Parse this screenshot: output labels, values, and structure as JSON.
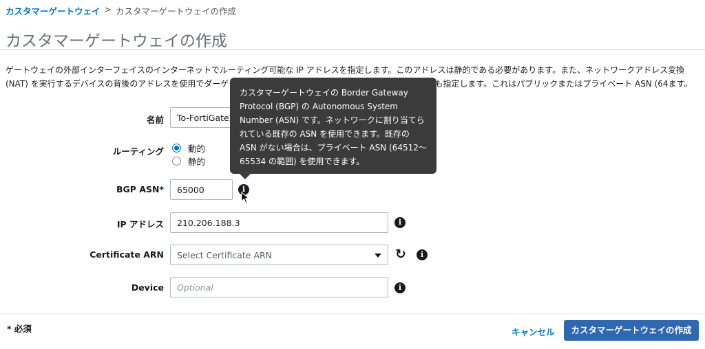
{
  "breadcrumb": {
    "parent": "カスタマーゲートウェイ",
    "separator": ">",
    "current": "カスタマーゲートウェイの作成"
  },
  "page_title": "カスタマーゲートウェイの作成",
  "description": "ゲートウェイの外部インターフェイスのインターネットでルーティング可能な IP アドレスを指定します。このアドレスは静的である必要があります。また、ネットワークアドレス変換 (NAT) を実行するデバイスの背後のアドレスを使用でダーゲートウェイプロトコル (BGP) 自律システム番号 (ASN) も指定します。これはパブリックまたはプライベート ASN (64ます。",
  "form": {
    "name": {
      "label": "名前",
      "value": "To-FortiGate2"
    },
    "routing": {
      "label": "ルーティング",
      "options": [
        "動的",
        "静的"
      ],
      "selected": "動的"
    },
    "bgp_asn": {
      "label": "BGP ASN*",
      "value": "65000"
    },
    "ip_address": {
      "label": "IP アドレス",
      "value": "210.206.188.3"
    },
    "certificate_arn": {
      "label": "Certificate ARN",
      "placeholder": "Select Certificate ARN"
    },
    "device": {
      "label": "Device",
      "placeholder": "Optional"
    }
  },
  "tooltip": {
    "text": "カスタマーゲートウェイの Border Gateway Protocol (BGP) の Autonomous System Number (ASN) です。ネットワークに割り当てられている既存の ASN を使用できます。既存の ASN がない場合は、プライベート ASN (64512〜65534 の範囲) を使用できます。"
  },
  "footer": {
    "required_note": "* 必須",
    "cancel_label": "キャンセル",
    "create_label": "カスタマーゲートウェイの作成"
  },
  "icons": {
    "info": "info-icon",
    "refresh": "refresh-icon",
    "dropdown": "chevron-down-icon",
    "cursor": "mouse-pointer-icon"
  },
  "colors": {
    "link": "#0073bb",
    "primary_button": "#2f68b0",
    "tooltip_bg": "#3b3b3b"
  }
}
